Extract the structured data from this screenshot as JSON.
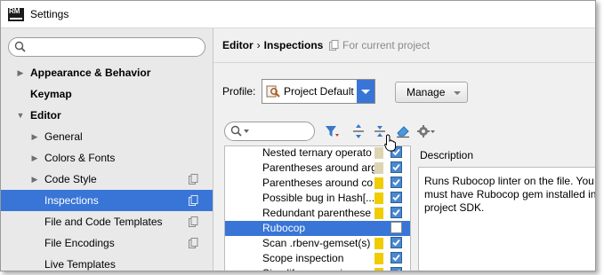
{
  "window": {
    "title": "Settings",
    "app_icon_text": "RM"
  },
  "sidebar": {
    "search_placeholder": "",
    "items": [
      {
        "label": "Appearance & Behavior",
        "level": 0,
        "expander": "collapsed",
        "bold": true,
        "project": false,
        "selected": false
      },
      {
        "label": "Keymap",
        "level": 0,
        "expander": "none",
        "bold": true,
        "project": false,
        "selected": false
      },
      {
        "label": "Editor",
        "level": 0,
        "expander": "expanded",
        "bold": true,
        "project": false,
        "selected": false
      },
      {
        "label": "General",
        "level": 1,
        "expander": "collapsed",
        "bold": false,
        "project": false,
        "selected": false
      },
      {
        "label": "Colors & Fonts",
        "level": 1,
        "expander": "collapsed",
        "bold": false,
        "project": false,
        "selected": false
      },
      {
        "label": "Code Style",
        "level": 1,
        "expander": "collapsed",
        "bold": false,
        "project": true,
        "selected": false
      },
      {
        "label": "Inspections",
        "level": 1,
        "expander": "none",
        "bold": false,
        "project": true,
        "selected": true
      },
      {
        "label": "File and Code Templates",
        "level": 1,
        "expander": "none",
        "bold": false,
        "project": true,
        "selected": false
      },
      {
        "label": "File Encodings",
        "level": 1,
        "expander": "none",
        "bold": false,
        "project": true,
        "selected": false
      },
      {
        "label": "Live Templates",
        "level": 1,
        "expander": "none",
        "bold": false,
        "project": false,
        "selected": false
      }
    ]
  },
  "breadcrumb": {
    "section": "Editor",
    "separator": "›",
    "page": "Inspections"
  },
  "scope_text": "For current project",
  "profile": {
    "label": "Profile:",
    "value": "Project Default"
  },
  "manage_label": "Manage",
  "toolbar_icons": [
    "filter-icon",
    "expand-all-icon",
    "collapse-all-icon",
    "reset-icon",
    "gear-icon"
  ],
  "inspections": [
    {
      "name": "Nested ternary operato",
      "severity": "weak-warning",
      "checked": true,
      "selected": false
    },
    {
      "name": "Parentheses around arg",
      "severity": "weak-warning",
      "checked": true,
      "selected": false
    },
    {
      "name": "Parentheses around co",
      "severity": "warning",
      "checked": true,
      "selected": false
    },
    {
      "name": "Possible bug in Hash[...",
      "severity": "warning",
      "checked": true,
      "selected": false
    },
    {
      "name": "Redundant parenthese",
      "severity": "warning",
      "checked": true,
      "selected": false
    },
    {
      "name": "Rubocop",
      "severity": "none",
      "checked": false,
      "selected": true
    },
    {
      "name": "Scan .rbenv-gemset(s)",
      "severity": "warning",
      "checked": true,
      "selected": false
    },
    {
      "name": "Scope inspection",
      "severity": "warning",
      "checked": true,
      "selected": false
    },
    {
      "name": "Simplify expression",
      "severity": "warning",
      "checked": true,
      "selected": false
    }
  ],
  "description": {
    "label": "Description",
    "text": "Runs Rubocop linter on the file. You must have Rubocop gem installed in project SDK."
  },
  "colors": {
    "selection": "#3875d7",
    "weak_warning": "#ddd4b4",
    "warning": "#f0cc00"
  }
}
